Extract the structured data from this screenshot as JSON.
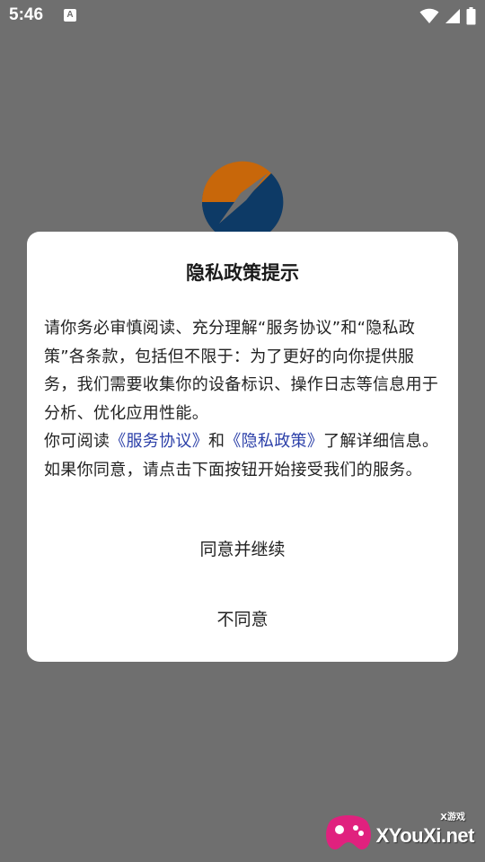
{
  "status_bar": {
    "time": "5:46",
    "notification_icon_letter": "A",
    "icons": [
      "wifi-icon",
      "signal-icon",
      "battery-icon"
    ]
  },
  "app": {
    "logo": "app-logo",
    "logo_colors": [
      "#c8670a",
      "#0d3a66"
    ]
  },
  "dialog": {
    "title": "隐私政策提示",
    "paragraph1": "请你务必审慎阅读、充分理解“服务协议”和“隐私政策”各条款，包括但不限于：为了更好的向你提供服务，我们需要收集你的设备标识、操作日志等信息用于分析、优化应用性能。",
    "paragraph2_prefix": "你可阅读",
    "link_service": "《服务协议》",
    "paragraph2_and": "和",
    "link_privacy": "《隐私政策》",
    "paragraph2_suffix": "了解详细信息。如果你同意，请点击下面按钮开始接受我们的服务。",
    "agree_label": "同意并继续",
    "disagree_label": "不同意"
  },
  "watermark": {
    "brand": "XYouXi.net",
    "tag": "X游戏"
  },
  "colors": {
    "overlay": "#6f6f6f",
    "link": "#2b3fa8",
    "dialog_bg": "#ffffff"
  }
}
